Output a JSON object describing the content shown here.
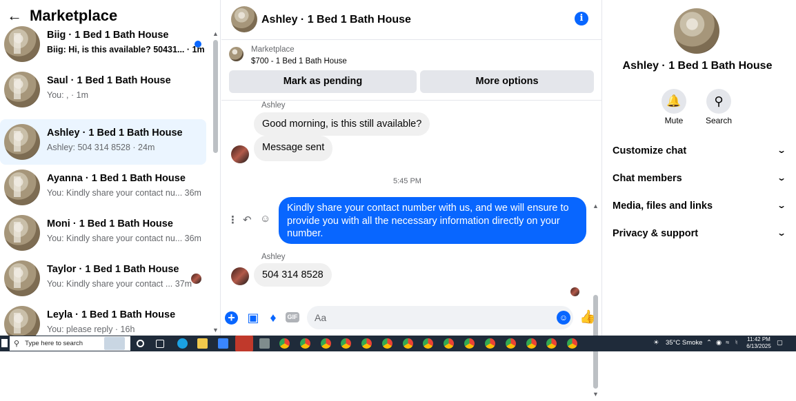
{
  "sidebar": {
    "title": "Marketplace",
    "conversations": [
      {
        "title": "Biig · 1 Bed 1 Bath House",
        "snippet": "Biig: Hi, is this available? 50431... · 1m",
        "unread": true
      },
      {
        "title": "Saul · 1 Bed 1 Bath House",
        "snippet": "You: , · 1m"
      },
      {
        "title": "Ashley · 1 Bed 1 Bath House",
        "snippet": "Ashley: 504 314 8528 · 24m",
        "active": true
      },
      {
        "title": "Ayanna · 1 Bed 1 Bath House",
        "snippet": "You: Kindly share your contact nu...  36m"
      },
      {
        "title": "Moni · 1 Bed 1 Bath House",
        "snippet": "You: Kindly share your contact nu...  36m"
      },
      {
        "title": "Taylor · 1 Bed 1 Bath House",
        "snippet": "You: Kindly share your contact ...  37m"
      },
      {
        "title": "Leyla · 1 Bed 1 Bath House",
        "snippet": "You: please reply · 16h"
      }
    ]
  },
  "chat": {
    "title": "Ashley · 1 Bed 1 Bath House",
    "listing": {
      "label": "Marketplace",
      "detail": "$700 - 1 Bed 1 Bath House"
    },
    "buttons": {
      "pending": "Mark as pending",
      "more": "More options"
    },
    "messages": {
      "sender1": "Ashley",
      "m1": "Good morning, is this still available?",
      "m2": "Message sent",
      "time": "5:45 PM",
      "mine": "Kindly share your contact number with us, and we will ensure to provide you with all the necessary information directly on your number.",
      "sender2": "Ashley",
      "m3": "504 314 8528"
    },
    "composer_placeholder": "Aa"
  },
  "details": {
    "name": "Ashley · 1 Bed 1 Bath House",
    "mute": "Mute",
    "search": "Search",
    "sections": [
      "Customize chat",
      "Chat members",
      "Media, files and links",
      "Privacy & support"
    ]
  },
  "taskbar": {
    "search": "Type here to search",
    "weather": "35°C  Smoke",
    "time": "11:42 PM",
    "date": "6/13/2025"
  },
  "colors": {
    "accent": "#0866ff",
    "active_row": "#ebf5ff"
  }
}
